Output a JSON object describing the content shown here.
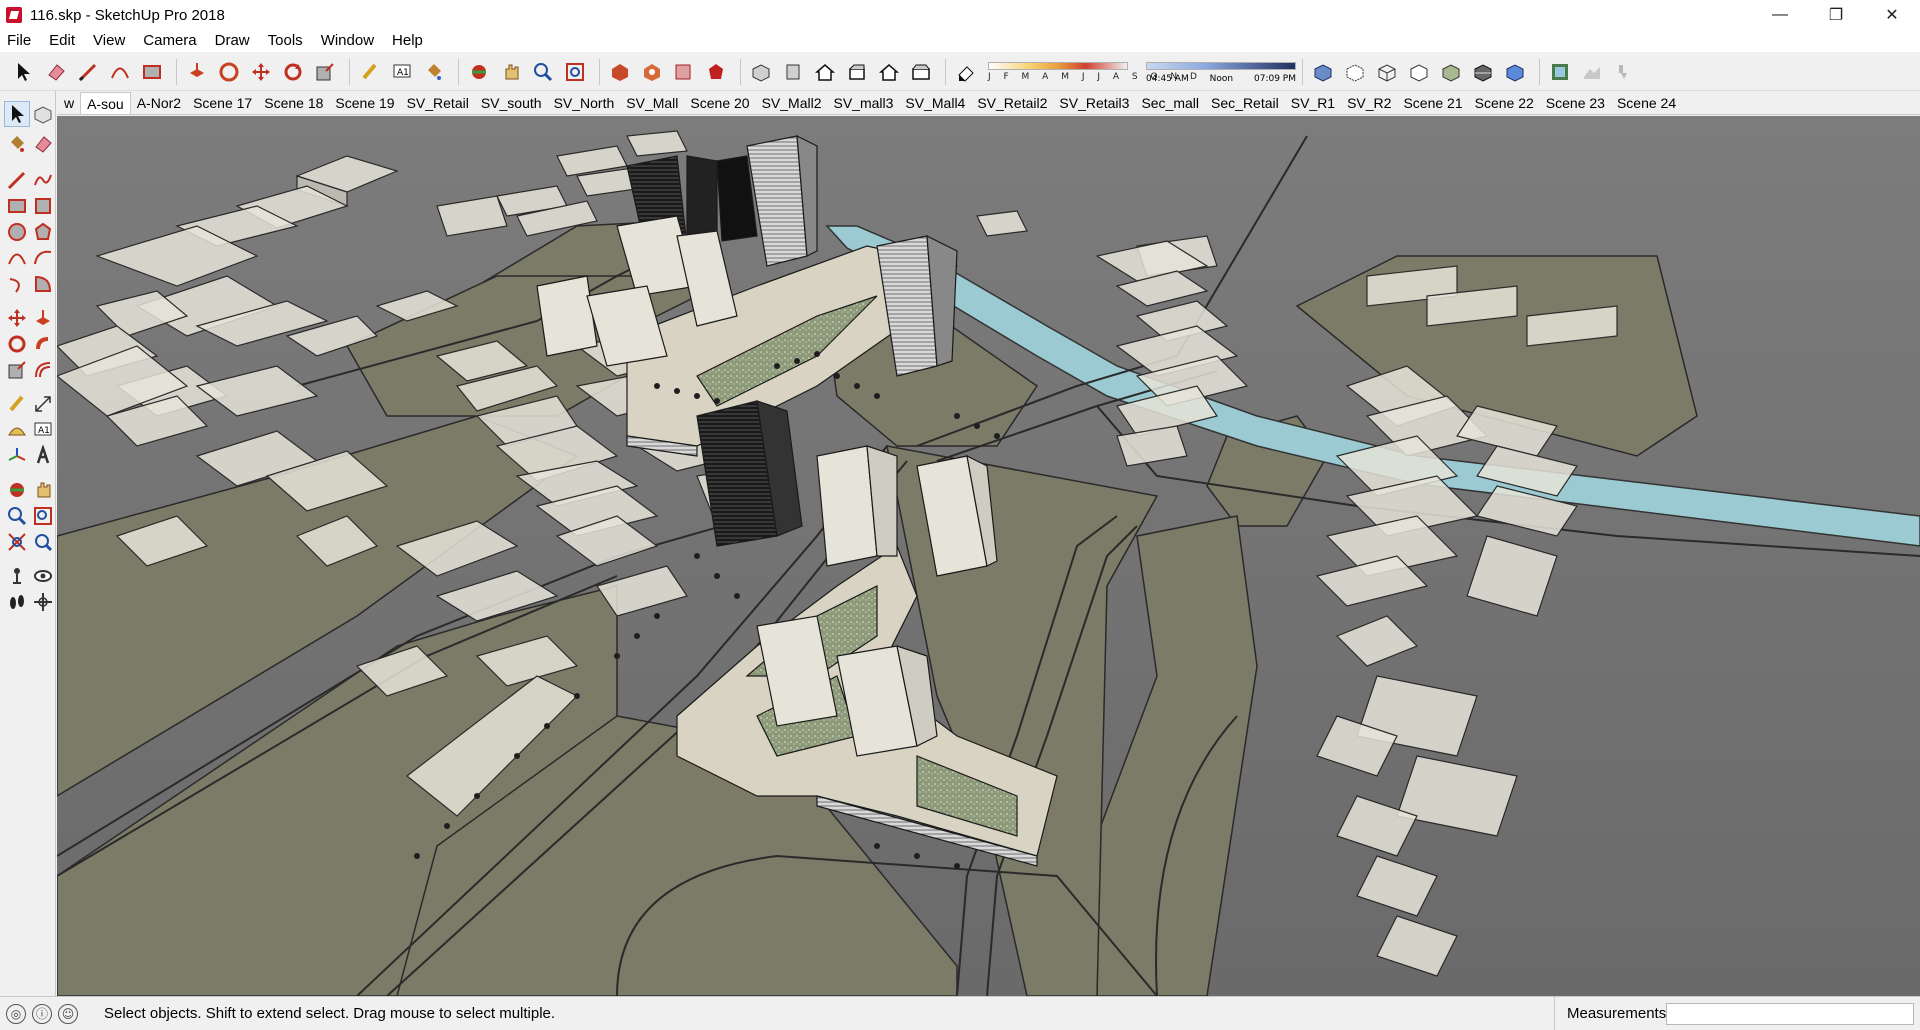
{
  "window": {
    "title": "116.skp - SketchUp Pro 2018",
    "minimize": "—",
    "restore": "❐",
    "close": "✕"
  },
  "menu": [
    "File",
    "Edit",
    "View",
    "Camera",
    "Draw",
    "Tools",
    "Window",
    "Help"
  ],
  "shadow": {
    "months": "J F M A M J J A S O N D",
    "time_start": "04:45 AM",
    "time_mid": "Noon",
    "time_end": "07:09 PM"
  },
  "scenes": {
    "tabs": [
      "w",
      "A-sou",
      "A-Nor2",
      "Scene 17",
      "Scene 18",
      "Scene 19",
      "SV_Retail",
      "SV_south",
      "SV_North",
      "SV_Mall",
      "Scene 20",
      "SV_Mall2",
      "SV_mall3",
      "SV_Mall4",
      "SV_Retail2",
      "SV_Retail3",
      "Sec_mall",
      "Sec_Retail",
      "SV_R1",
      "SV_R2",
      "Scene 21",
      "Scene 22",
      "Scene 23",
      "Scene 24"
    ],
    "active_index": 1
  },
  "status": {
    "message": "Select objects. Shift to extend select. Drag mouse to select multiple.",
    "measurements_label": "Measurements",
    "measurements_value": ""
  },
  "colors": {
    "ground": "#6e6e6e",
    "road": "#5a5a5a",
    "grass": "#7b7b68",
    "water": "#9ccad2",
    "building": "#e6e4d8",
    "brand": "#c8102e"
  }
}
